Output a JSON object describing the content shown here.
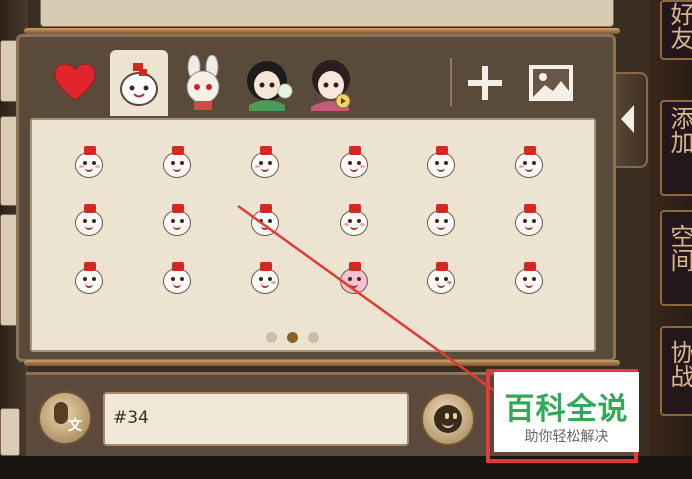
{
  "side_tabs": [
    {
      "label": "好友"
    },
    {
      "label": "添加"
    },
    {
      "label": "空间"
    },
    {
      "label": "协战"
    }
  ],
  "icons": {
    "favorites_tab": "heart-icon",
    "add_tab": "plus-icon",
    "image_tab": "image-icon",
    "collapse": "chevron-left-icon",
    "voice": "mic-icon",
    "emoji": "smiley-icon"
  },
  "chat": {
    "input_value": "#34",
    "voice_badge": "文"
  },
  "emoji_page": {
    "pages": 3,
    "current": 2
  },
  "watermark": {
    "title": "百科全说",
    "subtitle": "助你轻松解决"
  },
  "colors": {
    "accent": "#e03b37",
    "brand_green": "#2faa56",
    "panel": "#ece3d1"
  }
}
